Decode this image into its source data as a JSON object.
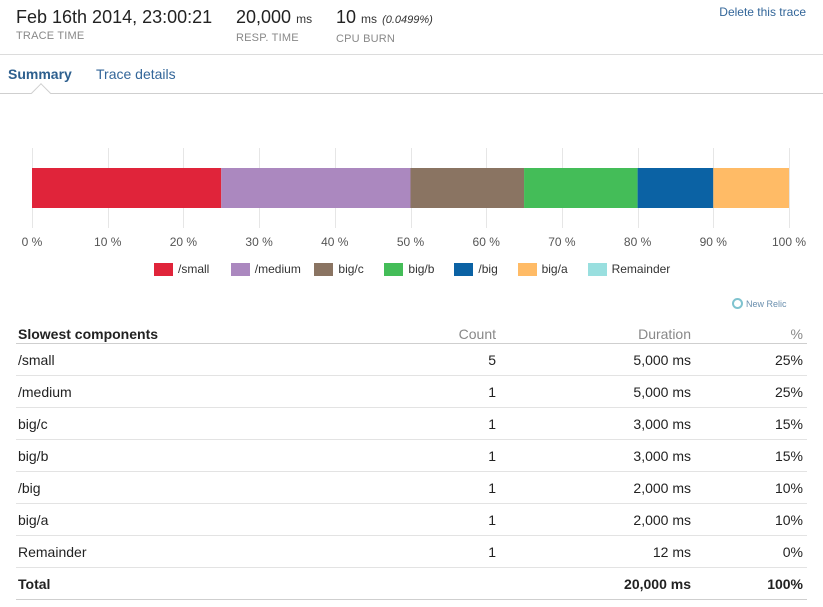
{
  "header": {
    "trace_time": {
      "value": "Feb 16th 2014, 23:00:21",
      "label": "TRACE TIME"
    },
    "resp_time": {
      "value": "20,000",
      "unit": "ms",
      "label": "RESP. TIME"
    },
    "cpu_burn": {
      "value": "10",
      "unit": "ms",
      "percent": "(0.0499%)",
      "label": "CPU BURN"
    },
    "delete_link": "Delete this trace"
  },
  "tabs": [
    {
      "label": "Summary",
      "active": true
    },
    {
      "label": "Trace details",
      "active": false
    }
  ],
  "chart_data": {
    "type": "bar",
    "orientation": "horizontal-stacked",
    "categories": [
      "/small",
      "/medium",
      "big/c",
      "big/b",
      "/big",
      "big/a",
      "Remainder"
    ],
    "values": [
      25,
      25,
      15,
      15,
      10,
      10,
      0
    ],
    "colors": [
      "#e0243a",
      "#ab88bf",
      "#8a7462",
      "#44bd58",
      "#0b62a4",
      "#ffbb66",
      "#99dfdf"
    ],
    "xlim": [
      0,
      100
    ],
    "xticks": [
      "0 %",
      "10 %",
      "20 %",
      "30 %",
      "40 %",
      "50 %",
      "60 %",
      "70 %",
      "80 %",
      "90 %",
      "100 %"
    ],
    "legend_position": "bottom-center",
    "grid": true
  },
  "branding": "New Relic",
  "table": {
    "headers": {
      "name": "Slowest components",
      "count": "Count",
      "duration": "Duration",
      "percent": "%"
    },
    "rows": [
      {
        "name": "/small",
        "count": "5",
        "duration": "5,000 ms",
        "percent": "25%"
      },
      {
        "name": "/medium",
        "count": "1",
        "duration": "5,000 ms",
        "percent": "25%"
      },
      {
        "name": "big/c",
        "count": "1",
        "duration": "3,000 ms",
        "percent": "15%"
      },
      {
        "name": "big/b",
        "count": "1",
        "duration": "3,000 ms",
        "percent": "15%"
      },
      {
        "name": "/big",
        "count": "1",
        "duration": "2,000 ms",
        "percent": "10%"
      },
      {
        "name": "big/a",
        "count": "1",
        "duration": "2,000 ms",
        "percent": "10%"
      },
      {
        "name": "Remainder",
        "count": "1",
        "duration": "12 ms",
        "percent": "0%"
      }
    ],
    "total": {
      "name": "Total",
      "duration": "20,000 ms",
      "percent": "100%"
    }
  }
}
